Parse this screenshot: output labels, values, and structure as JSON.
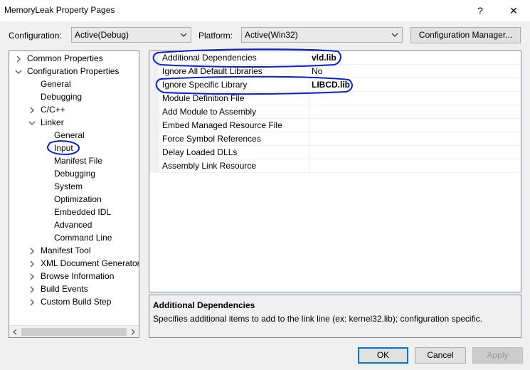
{
  "window": {
    "title": "MemoryLeak Property Pages",
    "help_label": "?",
    "close_label": "✕"
  },
  "toolbar": {
    "configuration_label": "Configuration:",
    "configuration_value": "Active(Debug)",
    "platform_label": "Platform:",
    "platform_value": "Active(Win32)",
    "config_manager_label": "Configuration Manager..."
  },
  "tree": [
    {
      "label": "Common Properties",
      "indent": 0,
      "expander": "collapsed"
    },
    {
      "label": "Configuration Properties",
      "indent": 0,
      "expander": "expanded"
    },
    {
      "label": "General",
      "indent": 1,
      "expander": "none"
    },
    {
      "label": "Debugging",
      "indent": 1,
      "expander": "none"
    },
    {
      "label": "C/C++",
      "indent": 1,
      "expander": "collapsed"
    },
    {
      "label": "Linker",
      "indent": 1,
      "expander": "expanded"
    },
    {
      "label": "General",
      "indent": 2,
      "expander": "none"
    },
    {
      "label": "Input",
      "indent": 2,
      "expander": "none"
    },
    {
      "label": "Manifest File",
      "indent": 2,
      "expander": "none"
    },
    {
      "label": "Debugging",
      "indent": 2,
      "expander": "none"
    },
    {
      "label": "System",
      "indent": 2,
      "expander": "none"
    },
    {
      "label": "Optimization",
      "indent": 2,
      "expander": "none"
    },
    {
      "label": "Embedded IDL",
      "indent": 2,
      "expander": "none"
    },
    {
      "label": "Advanced",
      "indent": 2,
      "expander": "none"
    },
    {
      "label": "Command Line",
      "indent": 2,
      "expander": "none"
    },
    {
      "label": "Manifest Tool",
      "indent": 1,
      "expander": "collapsed"
    },
    {
      "label": "XML Document Generator",
      "indent": 1,
      "expander": "collapsed"
    },
    {
      "label": "Browse Information",
      "indent": 1,
      "expander": "collapsed"
    },
    {
      "label": "Build Events",
      "indent": 1,
      "expander": "collapsed"
    },
    {
      "label": "Custom Build Step",
      "indent": 1,
      "expander": "collapsed"
    }
  ],
  "properties": [
    {
      "name": "Additional Dependencies",
      "value": "vld.lib",
      "bold": true
    },
    {
      "name": "Ignore All Default Libraries",
      "value": "No",
      "bold": false
    },
    {
      "name": "Ignore Specific Library",
      "value": "LIBCD.lib",
      "bold": true
    },
    {
      "name": "Module Definition File",
      "value": "",
      "bold": false
    },
    {
      "name": "Add Module to Assembly",
      "value": "",
      "bold": false
    },
    {
      "name": "Embed Managed Resource File",
      "value": "",
      "bold": false
    },
    {
      "name": "Force Symbol References",
      "value": "",
      "bold": false
    },
    {
      "name": "Delay Loaded DLLs",
      "value": "",
      "bold": false
    },
    {
      "name": "Assembly Link Resource",
      "value": "",
      "bold": false
    }
  ],
  "description": {
    "title": "Additional Dependencies",
    "text": "Specifies additional items to add to the link line (ex: kernel32.lib); configuration specific."
  },
  "buttons": {
    "ok": "OK",
    "cancel": "Cancel",
    "apply": "Apply"
  },
  "colors": {
    "annotation": "#0a1fd6",
    "default_button_border": "#0078d7"
  }
}
